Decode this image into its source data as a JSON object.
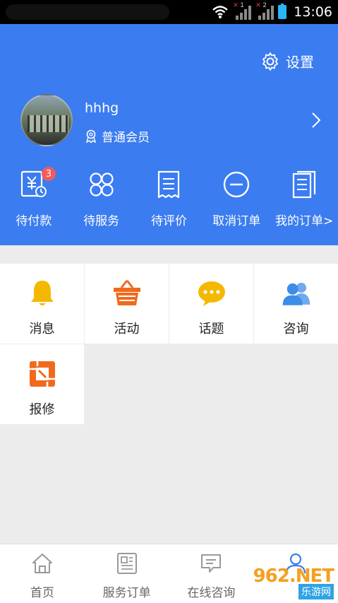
{
  "status_bar": {
    "time": "13:06"
  },
  "header": {
    "settings_label": "设置",
    "username": "hhhg",
    "member_level": "普通会员"
  },
  "orders": [
    {
      "label": "待付款",
      "icon": "payment-icon",
      "badge": "3"
    },
    {
      "label": "待服务",
      "icon": "service-icon"
    },
    {
      "label": "待评价",
      "icon": "review-icon"
    },
    {
      "label": "取消订单",
      "icon": "cancel-icon"
    },
    {
      "label": "我的订单>",
      "icon": "orders-icon"
    }
  ],
  "grid": [
    {
      "label": "消息",
      "icon": "bell-icon",
      "color": "#f5b800"
    },
    {
      "label": "活动",
      "icon": "basket-icon",
      "color": "#f06a1e"
    },
    {
      "label": "话题",
      "icon": "chat-bubble-icon",
      "color": "#f5b800"
    },
    {
      "label": "咨询",
      "icon": "people-icon",
      "color": "#3b8de8"
    },
    {
      "label": "报修",
      "icon": "repair-icon",
      "color": "#f06a1e"
    }
  ],
  "tabbar": [
    {
      "label": "首页",
      "icon": "home-icon"
    },
    {
      "label": "服务订单",
      "icon": "document-icon"
    },
    {
      "label": "在线咨询",
      "icon": "message-icon"
    },
    {
      "label": "",
      "icon": "user-icon",
      "active": true
    }
  ],
  "watermark": {
    "top": "962.NET",
    "bottom": "乐游网"
  },
  "colors": {
    "primary": "#3b7cf0",
    "badge": "#f45a5a",
    "background": "#ececec"
  }
}
